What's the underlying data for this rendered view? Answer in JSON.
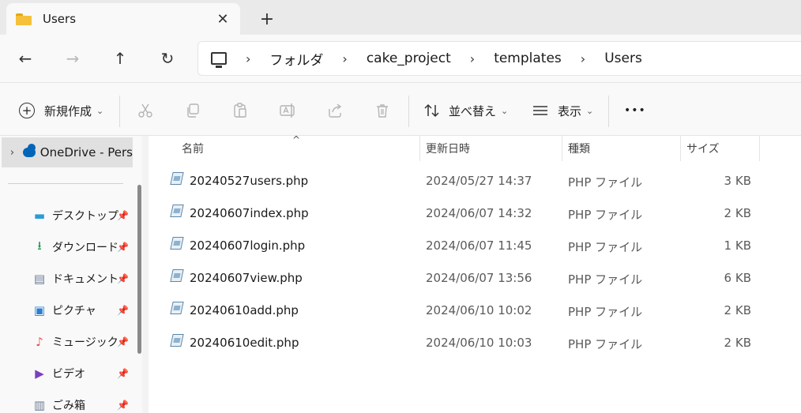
{
  "tab": {
    "title": "Users",
    "close_glyph": "✕",
    "new_tab_glyph": "+"
  },
  "nav": {
    "back_glyph": "←",
    "forward_glyph": "→",
    "up_glyph": "↑",
    "refresh_glyph": "↻",
    "breadcrumbs": [
      "フォルダ",
      "cake_project",
      "templates",
      "Users"
    ],
    "separator": "›"
  },
  "commands": {
    "new_label": "新規作成",
    "sort_label": "並べ替え",
    "view_label": "表示",
    "more_glyph": "•••",
    "chevron": "⌄"
  },
  "sidebar": {
    "onedrive_label": "OneDrive - Pers",
    "expand_glyph": "›",
    "pin_glyph": "📌",
    "quick_access": [
      {
        "label": "デスクトップ",
        "icon": "desktop-icon",
        "color": "#2b9bd6"
      },
      {
        "label": "ダウンロード",
        "icon": "download-icon",
        "color": "#1e8c4e"
      },
      {
        "label": "ドキュメント",
        "icon": "documents-icon",
        "color": "#6b7c93"
      },
      {
        "label": "ピクチャ",
        "icon": "pictures-icon",
        "color": "#2a7fd4"
      },
      {
        "label": "ミュージック",
        "icon": "music-icon",
        "color": "#e0584c"
      },
      {
        "label": "ビデオ",
        "icon": "videos-icon",
        "color": "#7b3fbf"
      },
      {
        "label": "ごみ箱",
        "icon": "recycle-bin-icon",
        "color": "#6b7c93"
      }
    ]
  },
  "columns": {
    "name": "名前",
    "modified": "更新日時",
    "type": "種類",
    "size": "サイズ",
    "sort_glyph": "^"
  },
  "files": [
    {
      "name": "20240527users.php",
      "modified": "2024/05/27 14:37",
      "type": "PHP ファイル",
      "size": "3 KB"
    },
    {
      "name": "20240607index.php",
      "modified": "2024/06/07 14:32",
      "type": "PHP ファイル",
      "size": "2 KB"
    },
    {
      "name": "20240607login.php",
      "modified": "2024/06/07 11:45",
      "type": "PHP ファイル",
      "size": "1 KB"
    },
    {
      "name": "20240607view.php",
      "modified": "2024/06/07 13:56",
      "type": "PHP ファイル",
      "size": "6 KB"
    },
    {
      "name": "20240610add.php",
      "modified": "2024/06/10 10:02",
      "type": "PHP ファイル",
      "size": "2 KB"
    },
    {
      "name": "20240610edit.php",
      "modified": "2024/06/10 10:03",
      "type": "PHP ファイル",
      "size": "2 KB"
    }
  ]
}
